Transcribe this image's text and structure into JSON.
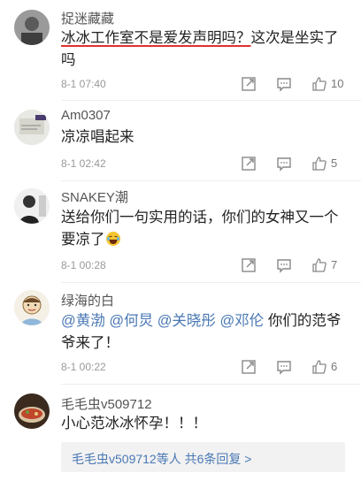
{
  "comments": [
    {
      "user": "捉迷藏藏",
      "text_underlined": "冰冰工作室不是爱发声明吗？",
      "text_rest": "这次是坐实了吗",
      "time": "8-1 07:40",
      "likes": "10"
    },
    {
      "user": "Am0307",
      "text": "凉凉唱起来",
      "time": "8-1 02:42",
      "likes": "5"
    },
    {
      "user": "SNAKEY潮",
      "text": "送给你们一句实用的话，你们的女神又一个要凉了",
      "emoji": "laughing-crying-emoji",
      "time": "8-1 00:28",
      "likes": "7"
    },
    {
      "user": "绿海的白",
      "mentions": [
        "@黄渤",
        "@何炅",
        "@关晓彤",
        "@邓伦"
      ],
      "text": "你们的范爷爷来了！",
      "time": "8-1 00:22",
      "likes": "6"
    },
    {
      "user": "毛毛虫v509712",
      "text": "小心范冰冰怀孕！！！"
    }
  ],
  "replies_summary": {
    "user": "毛毛虫v509712",
    "middle": "等人",
    "link": "共6条回复 >"
  },
  "colors": {
    "link": "#4a78b4",
    "underline": "#e0312f",
    "meta": "#999999"
  }
}
